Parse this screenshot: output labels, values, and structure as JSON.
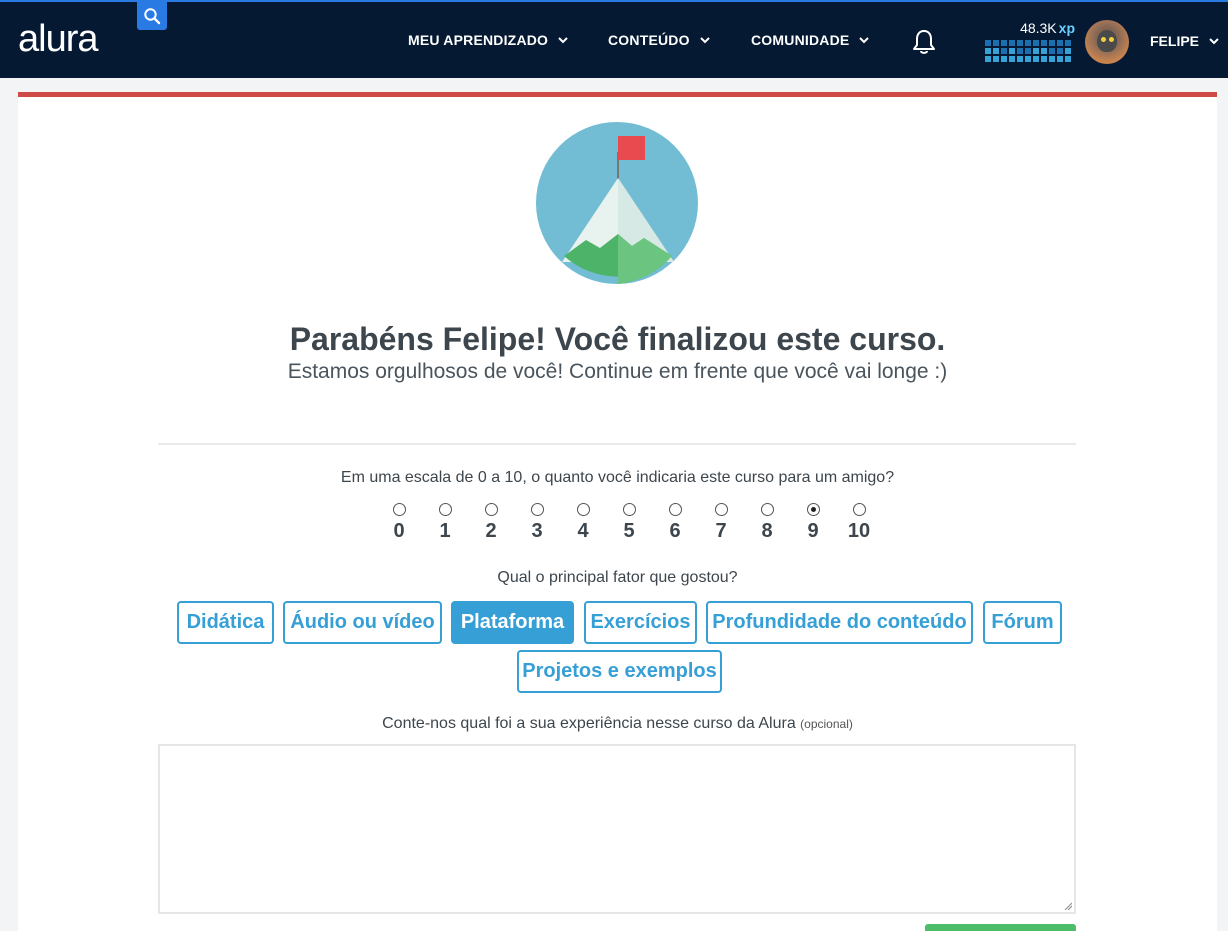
{
  "header": {
    "logo_text": "alura",
    "nav": [
      {
        "label": "MEU APRENDIZADO"
      },
      {
        "label": "CONTEÚDO"
      },
      {
        "label": "COMUNIDADE"
      }
    ],
    "xp_value": "48.3K",
    "xp_unit": "xp",
    "user_name": "FELIPE"
  },
  "main": {
    "title": "Parabéns Felipe! Você finalizou este curso.",
    "subtitle": "Estamos orgulhosos de você! Continue em frente que você vai longe :)",
    "nps_question": "Em uma escala de 0 a 10, o quanto você indicaria este curso para um amigo?",
    "nps_options": [
      "0",
      "1",
      "2",
      "3",
      "4",
      "5",
      "6",
      "7",
      "8",
      "9",
      "10"
    ],
    "nps_selected": "9",
    "factor_question": "Qual o principal fator que gostou?",
    "factors": [
      {
        "label": "Didática",
        "selected": false
      },
      {
        "label": "Áudio ou vídeo",
        "selected": false
      },
      {
        "label": "Plataforma",
        "selected": true
      },
      {
        "label": "Exercícios",
        "selected": false
      },
      {
        "label": "Profundidade do conteúdo",
        "selected": false
      },
      {
        "label": "Fórum",
        "selected": false
      },
      {
        "label": "Projetos e exemplos",
        "selected": false
      }
    ],
    "experience_label": "Conte-nos qual foi a sua experiência nesse curso da Alura",
    "experience_optional": "(opcional)",
    "experience_value": ""
  },
  "colors": {
    "header_bg": "#051933",
    "accent_blue": "#36a0d6",
    "card_top_border": "#cf4b47",
    "submit_green": "#4dbd6a"
  },
  "icons": [
    "search-icon",
    "chevron-down-icon",
    "bell-icon",
    "xp-grid-icon",
    "avatar",
    "mountain-flag-illustration"
  ]
}
